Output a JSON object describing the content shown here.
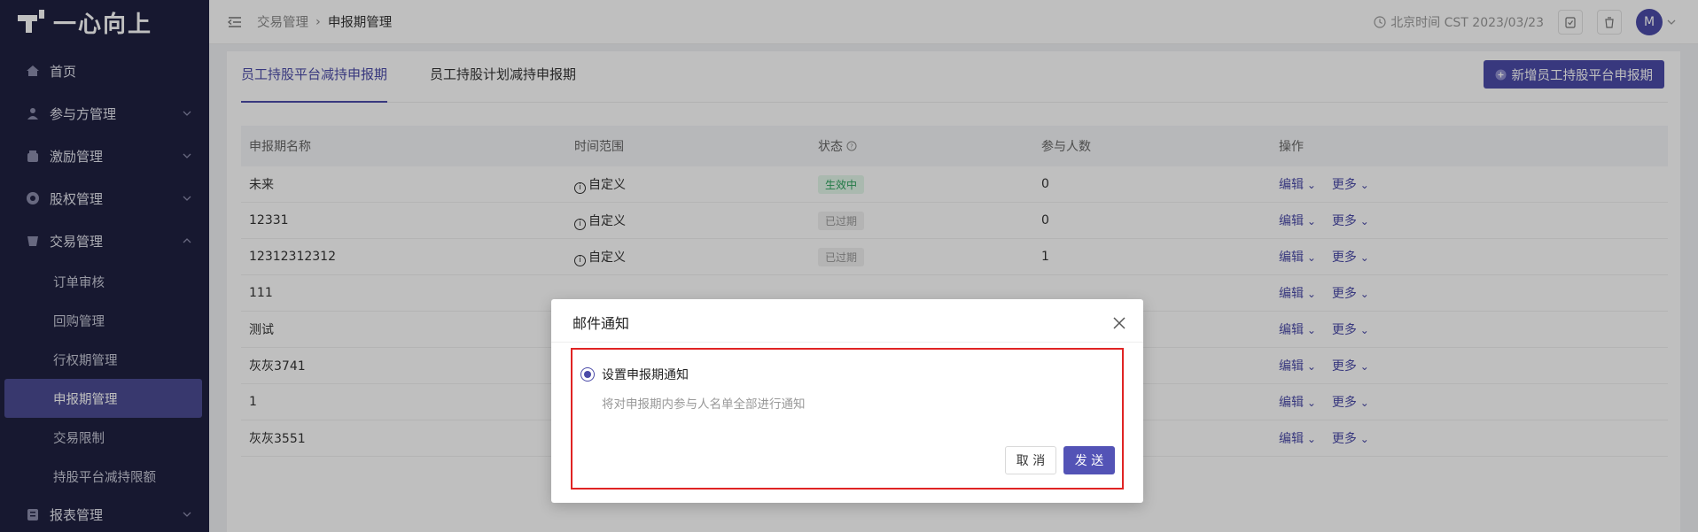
{
  "app": {
    "logo_text": "一心向上"
  },
  "sidebar": {
    "items": [
      {
        "label": "首页",
        "icon": "home-icon"
      },
      {
        "label": "参与方管理",
        "icon": "users-icon"
      },
      {
        "label": "激励管理",
        "icon": "gift-icon"
      },
      {
        "label": "股权管理",
        "icon": "chart-icon"
      },
      {
        "label": "交易管理",
        "icon": "trade-icon"
      },
      {
        "label": "报表管理",
        "icon": "report-icon"
      }
    ],
    "sub_items": [
      "订单审核",
      "回购管理",
      "行权期管理",
      "申报期管理",
      "交易限制",
      "持股平台减持限额"
    ]
  },
  "header": {
    "breadcrumb": [
      "交易管理",
      "申报期管理"
    ],
    "time_text": "北京时间 CST 2023/03/23",
    "avatar": "M"
  },
  "tabs": [
    "员工持股平台减持申报期",
    "员工持股计划减持申报期"
  ],
  "add_button": "新增员工持股平台申报期",
  "table": {
    "headers": [
      "申报期名称",
      "时间范围",
      "状态",
      "参与人数",
      "操作"
    ],
    "rows": [
      {
        "name": "未来",
        "range": "自定义",
        "status": "生效中",
        "count": "0"
      },
      {
        "name": "12331",
        "range": "自定义",
        "status": "已过期",
        "count": "0"
      },
      {
        "name": "12312312312",
        "range": "自定义",
        "status": "已过期",
        "count": "1"
      },
      {
        "name": "111",
        "range": "",
        "status": "",
        "count": ""
      },
      {
        "name": "测试",
        "range": "",
        "status": "",
        "count": ""
      },
      {
        "name": "灰灰3741",
        "range": "",
        "status": "",
        "count": ""
      },
      {
        "name": "1",
        "range": "",
        "status": "",
        "count": ""
      },
      {
        "name": "灰灰3551",
        "range": "",
        "status": "",
        "count": ""
      }
    ],
    "op_edit": "编辑",
    "op_more": "更多"
  },
  "modal": {
    "title": "邮件通知",
    "option_label": "设置申报期通知",
    "option_desc": "将对申报期内参与人名单全部进行通知",
    "cancel": "取 消",
    "send": "发 送"
  },
  "colors": {
    "primary": "#4b4ba8",
    "sidebar_bg": "#1f2040",
    "highlight": "#e02424"
  }
}
